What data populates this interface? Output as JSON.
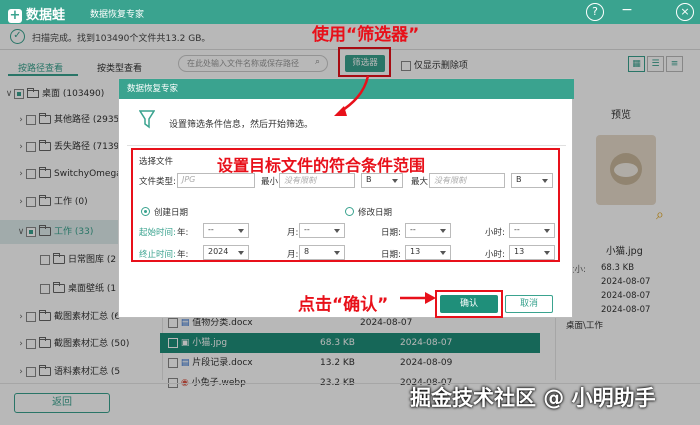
{
  "app": {
    "brand": "数据蛙",
    "subtitle": "数据恢复专家",
    "help_icon": "?",
    "min_icon": "−",
    "close_icon": "×"
  },
  "status": {
    "text": "扫描完成。找到103490个文件共13.2 GB。"
  },
  "annotations": {
    "use_filter": "使用“筛选器”",
    "set_conditions": "设置目标文件的符合条件范围",
    "click_confirm": "点击“确认”"
  },
  "toolbar": {
    "search_placeholder": "在此处输入文件名称或保存路径",
    "filter_label": "筛选器",
    "deleted_only": "仅显示删除项"
  },
  "tabs": [
    "按路径查看",
    "按类型查看"
  ],
  "tree": [
    {
      "label": "桌面 (103490)",
      "level": 0,
      "state": "partial"
    },
    {
      "label": "其他路径 (2935",
      "level": 1,
      "state": "off"
    },
    {
      "label": "丢失路径 (7139",
      "level": 1,
      "state": "off"
    },
    {
      "label": "SwitchyOmega",
      "level": 1,
      "state": "off"
    },
    {
      "label": "工作 (0)",
      "level": 1,
      "state": "off"
    },
    {
      "label": "工作 (33)",
      "level": 1,
      "state": "partial"
    },
    {
      "label": "日常图库 (2",
      "level": 2,
      "state": "off"
    },
    {
      "label": "桌面壁纸 (1",
      "level": 2,
      "state": "off"
    },
    {
      "label": "截图素材汇总 (6",
      "level": 1,
      "state": "off"
    },
    {
      "label": "截图素材汇总 (50)",
      "level": 1,
      "state": "off"
    },
    {
      "label": "语料素材汇总 (5",
      "level": 1,
      "state": "off"
    }
  ],
  "files": [
    {
      "name": "值物分类.docx",
      "size": "",
      "date": "2024-08-07",
      "state": "off"
    },
    {
      "name": "小猫.jpg",
      "size": "68.3 KB",
      "date": "2024-08-07",
      "state": "on"
    },
    {
      "name": "片段记录.docx",
      "size": "13.2 KB",
      "date": "2024-08-09",
      "state": "off"
    },
    {
      "name": "小兔子.webp",
      "size": "23.2 KB",
      "date": "2024-08-07",
      "state": "off"
    }
  ],
  "preview": {
    "title": "预览",
    "filename": "小猫.jpg",
    "size_label": "大小:",
    "size": "68.3 KB",
    "date1": "2024-08-07",
    "date2": "2024-08-07",
    "date3": "2024-08-07",
    "path": "桌面\\工作"
  },
  "dialog": {
    "title": "数据恢复专家",
    "hint": "设置筛选条件信息，然后开始筛选。",
    "section": "选择文件",
    "file_type_label": "文件类型:",
    "file_type_placeholder": "JPG",
    "min_label": "最小:",
    "min_placeholder": "没有限制",
    "min_unit": "B",
    "max_label": "最大:",
    "max_placeholder": "没有限制",
    "max_unit": "B",
    "created_label": "创建日期",
    "modified_label": "修改日期",
    "start_label": "起始时间:",
    "end_label": "终止时间:",
    "year_label": "年:",
    "month_label": "月:",
    "day_label": "日期:",
    "hour_label": "小时:",
    "start": {
      "year": "--",
      "month": "--",
      "day": "--",
      "hour": "--"
    },
    "end": {
      "year": "2024",
      "month": "8",
      "day": "13",
      "hour": "13"
    },
    "ok": "确认",
    "cancel": "取消"
  },
  "footer": {
    "back": "返回"
  },
  "watermark": "掘金技术社区 @ 小明助手"
}
